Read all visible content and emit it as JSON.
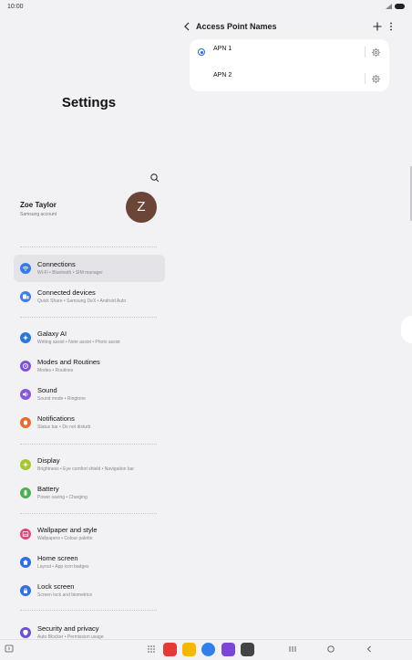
{
  "status_bar": {
    "time": "10:00"
  },
  "left": {
    "title": "Settings",
    "profile": {
      "name": "Zoe Taylor",
      "subtitle": "Samsung account",
      "avatar_letter": "Z"
    },
    "menu": [
      {
        "title": "Connections",
        "subtitle": "Wi-Fi • Bluetooth • SIM manager",
        "color": "#3478f6",
        "icon": "wifi-icon"
      },
      {
        "title": "Connected devices",
        "subtitle": "Quick Share • Samsung DeX • Android Auto",
        "color": "#3e7cf0",
        "icon": "devices-icon"
      },
      {
        "title": "Galaxy AI",
        "subtitle": "Writing assist • Note assist • Photo assist",
        "color": "#2b77d9",
        "icon": "ai-icon"
      },
      {
        "title": "Modes and Routines",
        "subtitle": "Modes • Routines",
        "color": "#7c4fe0",
        "icon": "modes-icon"
      },
      {
        "title": "Sound",
        "subtitle": "Sound mode • Ringtone",
        "color": "#8a55dd",
        "icon": "sound-icon"
      },
      {
        "title": "Notifications",
        "subtitle": "Status bar • Do not disturb",
        "color": "#e96a2c",
        "icon": "bell-icon"
      },
      {
        "title": "Display",
        "subtitle": "Brightness • Eye comfort shield • Navigation bar",
        "color": "#a5c52a",
        "icon": "display-icon"
      },
      {
        "title": "Battery",
        "subtitle": "Power saving • Charging",
        "color": "#4caf50",
        "icon": "battery-icon"
      },
      {
        "title": "Wallpaper and style",
        "subtitle": "Wallpapers • Colour palette",
        "color": "#e0457a",
        "icon": "wallpaper-icon"
      },
      {
        "title": "Home screen",
        "subtitle": "Layout • App icon badges",
        "color": "#2f6ee8",
        "icon": "home-icon"
      },
      {
        "title": "Lock screen",
        "subtitle": "Screen lock and biometrics",
        "color": "#2f6ee8",
        "icon": "lock-icon"
      },
      {
        "title": "Security and privacy",
        "subtitle": "Auto Blocker • Permission usage",
        "color": "#6c4fd6",
        "icon": "shield-icon"
      }
    ]
  },
  "right": {
    "title": "Access Point Names",
    "apns": [
      {
        "label": "APN 1",
        "selected": true
      },
      {
        "label": "APN 2",
        "selected": false
      }
    ]
  }
}
